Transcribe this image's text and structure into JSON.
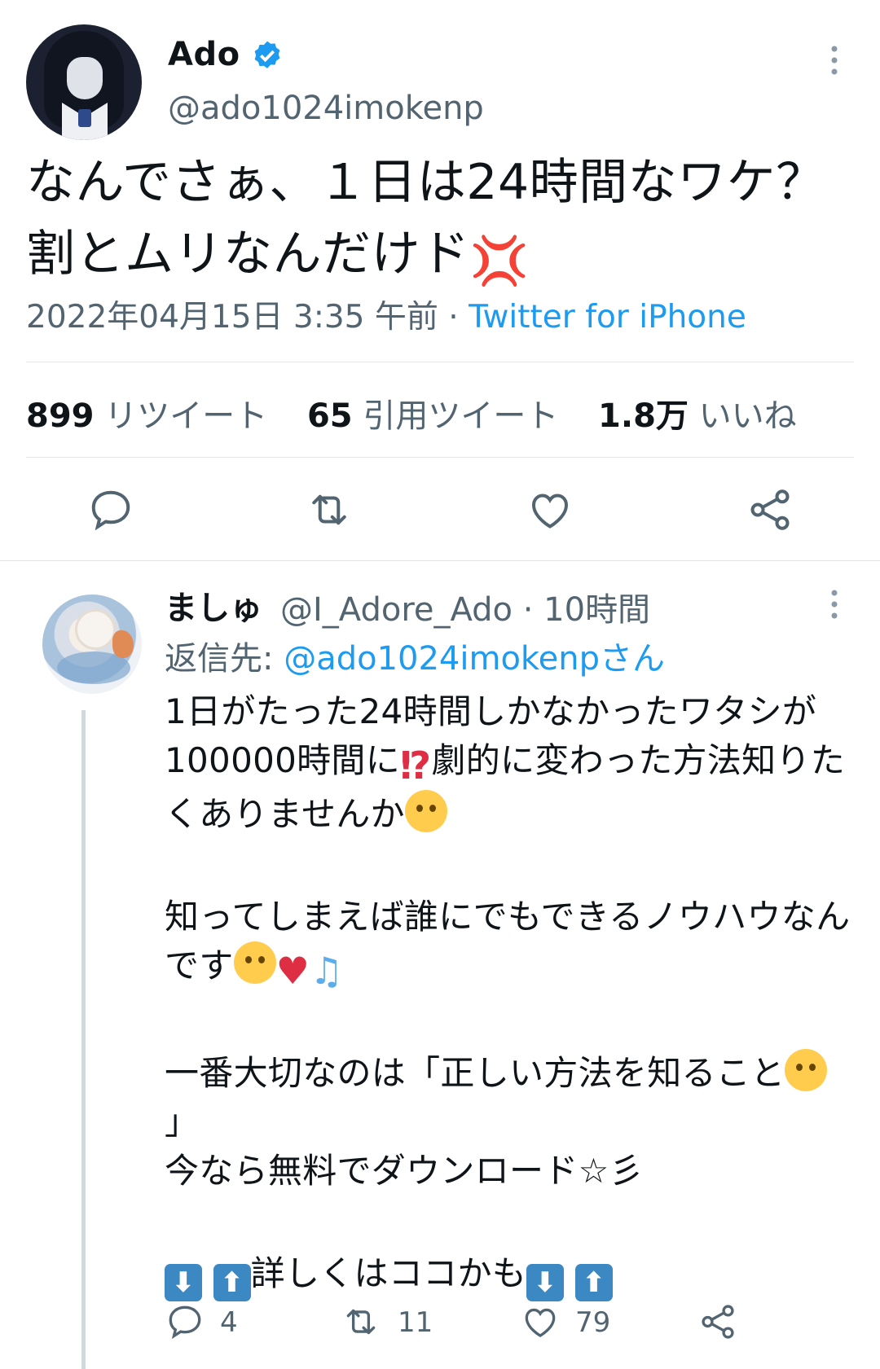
{
  "tweet": {
    "author_name": "Ado",
    "author_handle": "@ado1024imokenp",
    "text": "なんでさぁ、１日は24時間なワケ？割とムリなんだけド",
    "text_emoji": "anger-symbol",
    "datetime": "2022年04月15日 3:35 午前",
    "separator": "·",
    "source": "Twitter for iPhone"
  },
  "stats": {
    "retweets_count": "899",
    "retweets_label": "リツイート",
    "quotes_count": "65",
    "quotes_label": "引用ツイート",
    "likes_count": "1.8万",
    "likes_label": "いいね"
  },
  "actions": [
    "reply-icon",
    "retweet-icon",
    "like-icon",
    "share-icon"
  ],
  "reply": {
    "author_name": "ましゅ",
    "author_handle_time": "@I_Adore_Ado · 10時間",
    "replying_prefix": "返信先:",
    "replying_to": "@ado1024imokenpさん",
    "line1": "1日がたった24時間しかなかったワタシが100000時間に",
    "line1b": "劇的に変わった方法知りたくありませんか",
    "line2": "知ってしまえば誰にでもできるノウハウなんです",
    "line3a": "一番大切なのは「正しい方法を知ること",
    "line3b": "」",
    "line4": "今なら無料でダウンロード☆彡",
    "line5": "詳しくはココかも",
    "reply_count": "4",
    "retweet_count": "11",
    "like_count": "79"
  },
  "colors": {
    "accent": "#1d9bf0",
    "secondary_text": "#536471",
    "verified": "#1d9bf0"
  }
}
